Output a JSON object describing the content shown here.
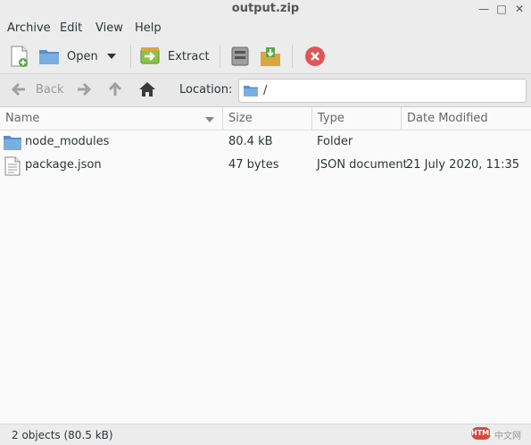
{
  "window": {
    "title": "output.zip",
    "minimize": "—",
    "maximize": "□",
    "close": "✕"
  },
  "menu": [
    "Archive",
    "Edit",
    "View",
    "Help"
  ],
  "toolbar": {
    "open_label": "Open",
    "extract_label": "Extract"
  },
  "nav": {
    "back_label": "Back",
    "location_label": "Location:",
    "location_value": "/"
  },
  "columns": {
    "name": "Name",
    "size": "Size",
    "type": "Type",
    "modified": "Date Modified"
  },
  "files": [
    {
      "name": "node_modules",
      "size": "80.4 kB",
      "type": "Folder",
      "modified": "",
      "icon": "folder-icon"
    },
    {
      "name": "package.json",
      "size": "47 bytes",
      "type": "JSON document",
      "modified": "21 July 2020, 11:35",
      "icon": "file-icon"
    }
  ],
  "status": {
    "text": "2 objects (80.5 kB)"
  },
  "watermark": {
    "badge": "HTML",
    "text": "中文网"
  },
  "colors": {
    "folder": "#5b8fc9",
    "close_red": "#e05656",
    "selection": "#fafafa"
  }
}
